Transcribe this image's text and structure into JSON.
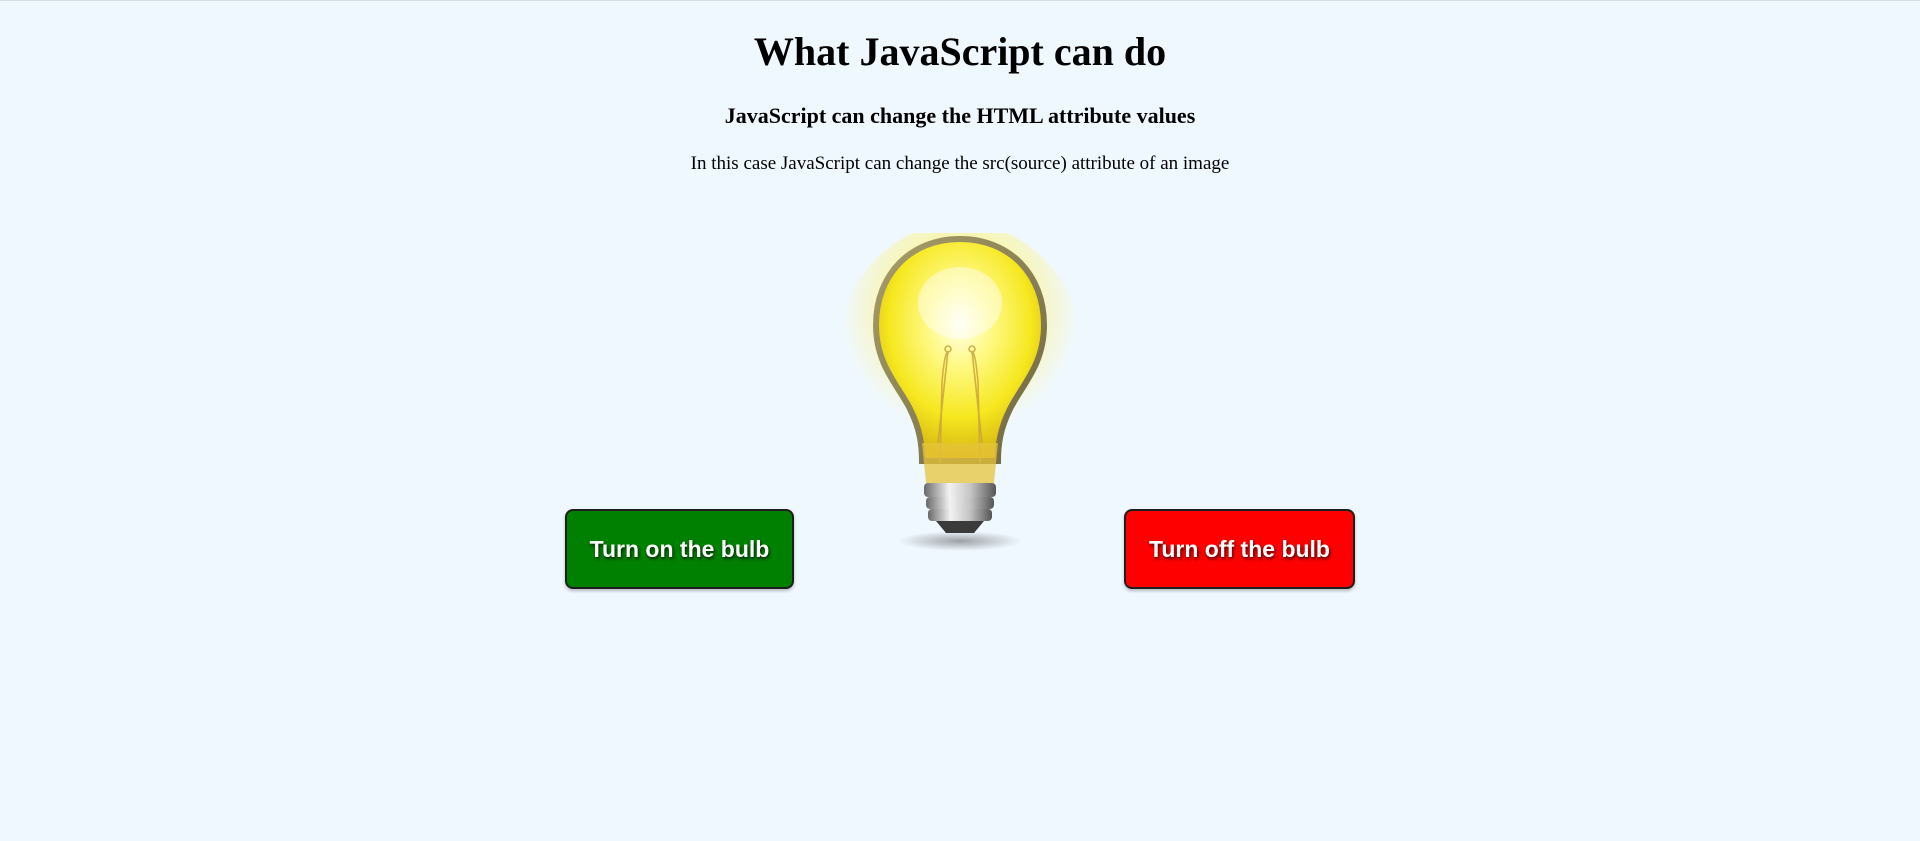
{
  "page": {
    "title": "What JavaScript can do",
    "subtitle": "JavaScript can change the HTML attribute values",
    "description": "In this case JavaScript can change the src(source) attribute of an image"
  },
  "bulb": {
    "icon": "lightbulb-on-icon",
    "state": "on",
    "glow_color": "#fff36a"
  },
  "buttons": {
    "turn_on": {
      "label": "Turn on the bulb",
      "color": "#008000"
    },
    "turn_off": {
      "label": "Turn off the bulb",
      "color": "#ff0000"
    }
  },
  "background_color": "#f0f8ff"
}
